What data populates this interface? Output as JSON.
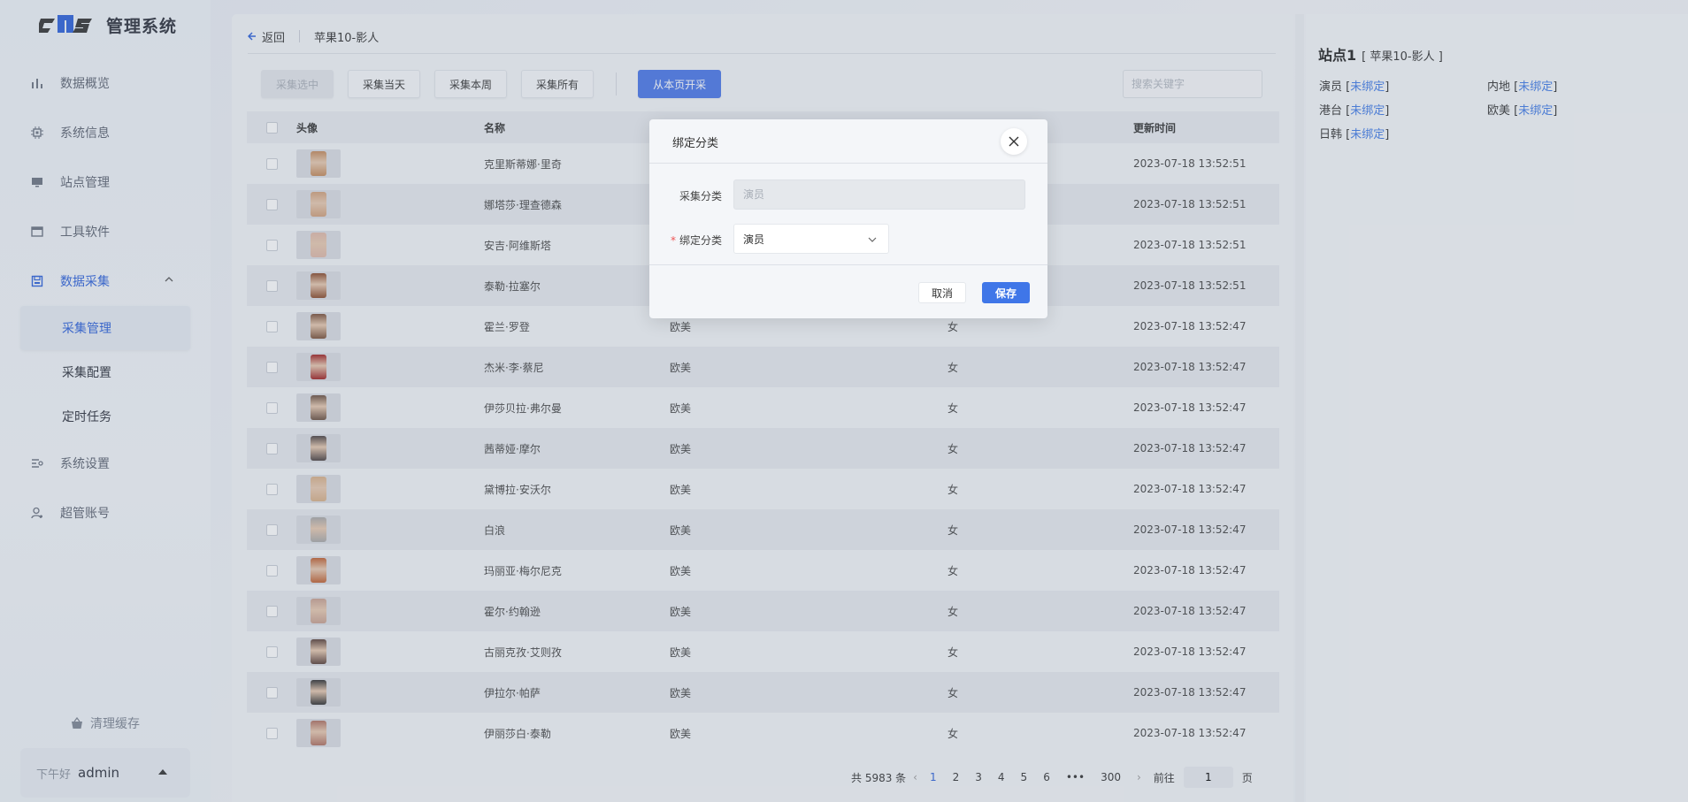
{
  "sidebar": {
    "logo_mark": "cms",
    "logo_text": "管理系统",
    "menu": [
      {
        "label": "数据概览",
        "icon": "bar-chart-icon"
      },
      {
        "label": "系统信息",
        "icon": "chip-icon"
      },
      {
        "label": "站点管理",
        "icon": "monitor-icon"
      },
      {
        "label": "工具软件",
        "icon": "window-icon"
      },
      {
        "label": "数据采集",
        "icon": "save-icon"
      }
    ],
    "submenu": [
      {
        "label": "采集管理"
      },
      {
        "label": "采集配置"
      },
      {
        "label": "定时任务"
      }
    ],
    "menu_after": [
      {
        "label": "系统设置",
        "icon": "settings-icon"
      },
      {
        "label": "超管账号",
        "icon": "user-icon"
      }
    ],
    "clear_cache": "清理缓存",
    "greeting": "下午好",
    "username": "admin"
  },
  "main": {
    "back": "返回",
    "breadcrumb": "苹果10-影人",
    "toolbar": {
      "collect_selected": "采集选中",
      "collect_today": "采集当天",
      "collect_week": "采集本周",
      "collect_all": "采集所有",
      "collect_from_page": "从本页开采"
    },
    "search_placeholder": "搜索关键字",
    "columns": {
      "avatar": "头像",
      "name": "名称",
      "time": "更新时间"
    },
    "rows": [
      {
        "name": "克里斯蒂娜·里奇",
        "category": "",
        "sex": "",
        "time": "2023-07-18 13:52:51",
        "color": "#c48a5a"
      },
      {
        "name": "娜塔莎·理查德森",
        "category": "",
        "sex": "",
        "time": "2023-07-18 13:52:51",
        "color": "#d2a07a"
      },
      {
        "name": "安吉·阿维斯塔",
        "category": "",
        "sex": "",
        "time": "2023-07-18 13:52:51",
        "color": "#e0b8a8"
      },
      {
        "name": "泰勒·拉塞尔",
        "category": "",
        "sex": "",
        "time": "2023-07-18 13:52:51",
        "color": "#8a4a2a"
      },
      {
        "name": "霍兰·罗登",
        "category": "欧美",
        "sex": "女",
        "time": "2023-07-18 13:52:47",
        "color": "#7a5038"
      },
      {
        "name": "杰米·李·蔡尼",
        "category": "欧美",
        "sex": "女",
        "time": "2023-07-18 13:52:47",
        "color": "#a02020"
      },
      {
        "name": "伊莎贝拉·弗尔曼",
        "category": "欧美",
        "sex": "女",
        "time": "2023-07-18 13:52:47",
        "color": "#6a5040"
      },
      {
        "name": "茜蒂娅·摩尔",
        "category": "欧美",
        "sex": "女",
        "time": "2023-07-18 13:52:47",
        "color": "#4a4040"
      },
      {
        "name": "黛博拉·安沃尔",
        "category": "欧美",
        "sex": "女",
        "time": "2023-07-18 13:52:47",
        "color": "#d8b088"
      },
      {
        "name": "白浪",
        "category": "欧美",
        "sex": "女",
        "time": "2023-07-18 13:52:47",
        "color": "#a8a8a8"
      },
      {
        "name": "玛丽亚·梅尔尼克",
        "category": "欧美",
        "sex": "女",
        "time": "2023-07-18 13:52:47",
        "color": "#c06030"
      },
      {
        "name": "霍尔·约翰逊",
        "category": "欧美",
        "sex": "女",
        "time": "2023-07-18 13:52:47",
        "color": "#c8a090"
      },
      {
        "name": "古丽克孜·艾则孜",
        "category": "欧美",
        "sex": "女",
        "time": "2023-07-18 13:52:47",
        "color": "#5a4038"
      },
      {
        "name": "伊拉尔·帕萨",
        "category": "欧美",
        "sex": "女",
        "time": "2023-07-18 13:52:47",
        "color": "#303030"
      },
      {
        "name": "伊丽莎白·泰勒",
        "category": "欧美",
        "sex": "女",
        "time": "2023-07-18 13:52:47",
        "color": "#b07060"
      }
    ],
    "pager": {
      "total": "共 5983 条",
      "prev": "‹",
      "pages": [
        "1",
        "2",
        "3",
        "4",
        "5",
        "6"
      ],
      "ellipsis": "•••",
      "last": "300",
      "next": "›",
      "goto": "前往",
      "goto_value": "1",
      "page_unit": "页"
    }
  },
  "right_panel": {
    "site": "站点1",
    "source": "[ 苹果10-影人 ]",
    "bindings": [
      {
        "label": "演员",
        "status": "未绑定"
      },
      {
        "label": "内地",
        "status": "未绑定"
      },
      {
        "label": "港台",
        "status": "未绑定"
      },
      {
        "label": "欧美",
        "status": "未绑定"
      },
      {
        "label": "日韩",
        "status": "未绑定"
      }
    ]
  },
  "modal": {
    "title": "绑定分类",
    "source_label": "采集分类",
    "source_placeholder": "演员",
    "bind_label": "绑定分类",
    "bind_value": "演员",
    "cancel": "取消",
    "save": "保存"
  },
  "colors": {
    "primary": "#4a77e8",
    "link": "#3f7ae6",
    "active_text": "#2b5fd9"
  }
}
